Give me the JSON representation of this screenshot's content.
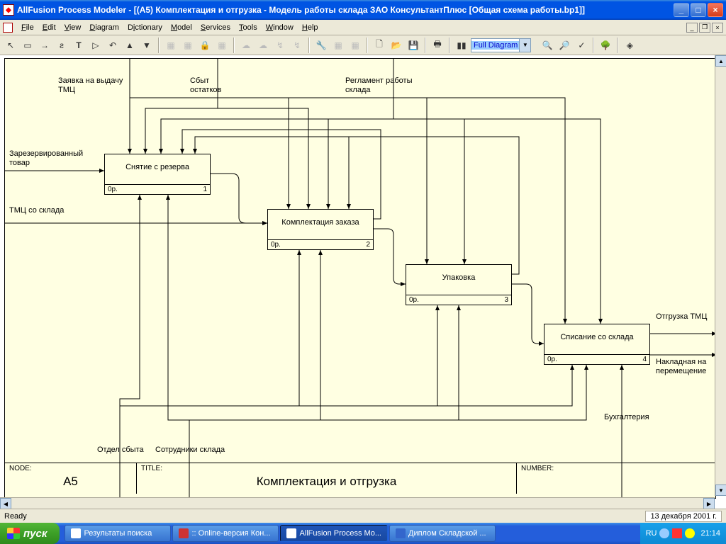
{
  "titlebar": {
    "text": "AllFusion Process Modeler  - [(А5) Комплектация  и отгрузка - Модель работы склада ЗАО КонсультантПлюс  [Общая схема работы.bp1]]"
  },
  "menubar": {
    "items": [
      "File",
      "Edit",
      "View",
      "Diagram",
      "Dictionary",
      "Model",
      "Services",
      "Tools",
      "Window",
      "Help"
    ]
  },
  "toolbar": {
    "zoom_select": "Full Diagram"
  },
  "diagram": {
    "inputs": {
      "reserved_goods": "Зарезервированный товар",
      "tmc_from_warehouse": "ТМЦ со склада"
    },
    "controls": {
      "request_tmc": "Заявка на выдачу ТМЦ",
      "sales_residuals": "Сбыт остатков",
      "warehouse_regulations": "Регламент работы склада"
    },
    "mechanisms": {
      "sales_dept": "Отдел сбыта",
      "warehouse_staff": "Сотрудники склада",
      "accounting": "Бухгалтерия"
    },
    "outputs": {
      "shipped_tmc": "Отгрузка ТМЦ",
      "transfer_note": "Накладная на перемещение"
    },
    "boxes": {
      "b1": {
        "title": "Снятие с резерва",
        "cost": "0р.",
        "num": "1"
      },
      "b2": {
        "title": "Комплектация заказа",
        "cost": "0р.",
        "num": "2"
      },
      "b3": {
        "title": "Упаковка",
        "cost": "0р.",
        "num": "3"
      },
      "b4": {
        "title": "Списание со склада",
        "cost": "0р.",
        "num": "4"
      }
    },
    "footer": {
      "node_label": "NODE:",
      "node_val": "А5",
      "title_label": "TITLE:",
      "title_val": "Комплектация  и отгрузка",
      "number_label": "NUMBER:"
    }
  },
  "statusbar": {
    "text": "Ready",
    "date": "13 декабря 2001 г."
  },
  "taskbar": {
    "start": "пуск",
    "items": [
      "Результаты поиска",
      ":: Online-версия Кон...",
      "AllFusion Process Mo...",
      "Диплом Складской ..."
    ],
    "lang": "RU",
    "clock": "21:14"
  }
}
